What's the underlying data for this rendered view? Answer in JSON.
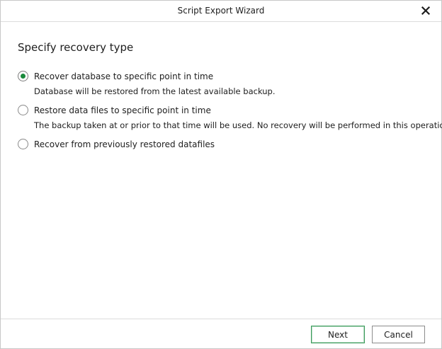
{
  "window": {
    "title": "Script Export Wizard"
  },
  "page": {
    "heading": "Specify recovery type"
  },
  "options": [
    {
      "label": "Recover database to specific point in time",
      "description": "Database will be restored from the latest available backup.",
      "selected": true
    },
    {
      "label": "Restore data files to specific point in time",
      "description": "The backup taken at or prior to that time will be used. No recovery will be performed in this operation.",
      "selected": false
    },
    {
      "label": "Recover from previously restored datafiles",
      "selected": false
    }
  ],
  "footer": {
    "next_label": "Next",
    "cancel_label": "Cancel"
  },
  "colors": {
    "accent": "#1a8a3c",
    "primary_border": "#3a9a5a"
  },
  "icons": {
    "close": "close-icon"
  }
}
